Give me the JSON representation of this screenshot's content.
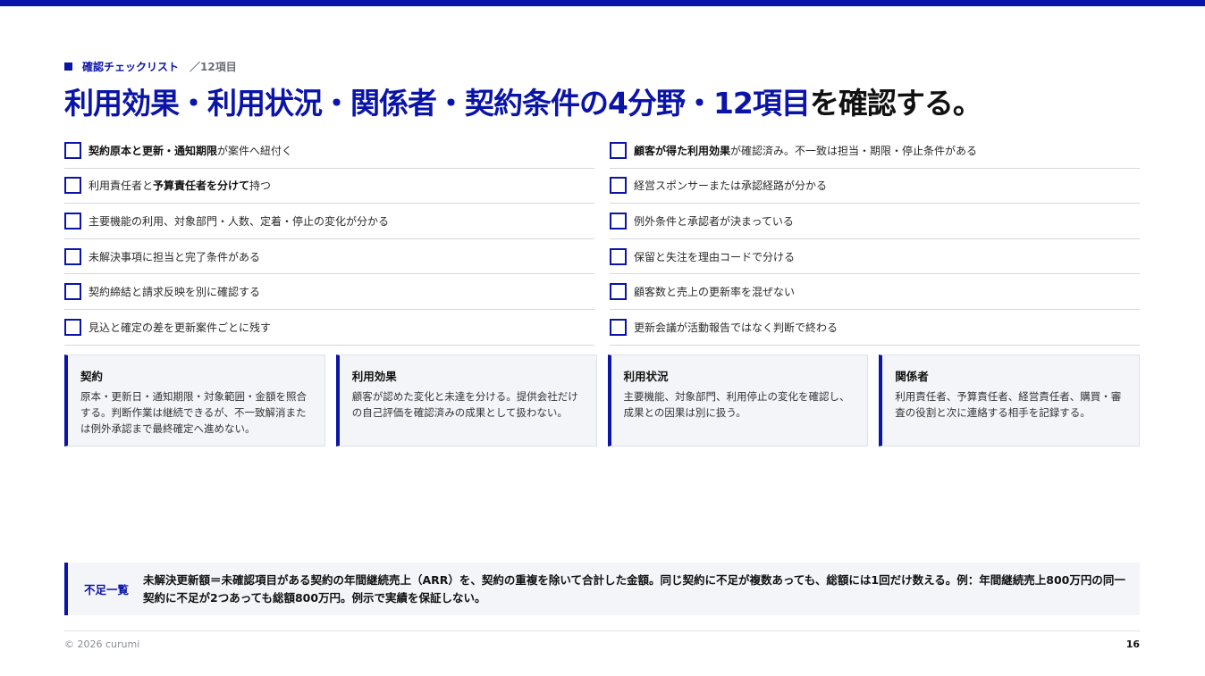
{
  "header": {
    "eyebrow_label": "確認チェックリスト",
    "eyebrow_count": "／12項目",
    "title_highlight": "利用効果・利用状況・関係者・契約条件の4分野・12項目",
    "title_rest": "を確認する。"
  },
  "checklist": {
    "left": [
      {
        "bold": "契約原本と更新・通知期限",
        "pre": "",
        "post": "が案件へ紐付く"
      },
      {
        "pre": "利用責任者と",
        "bold": "予算責任者を分けて",
        "post": "持つ"
      },
      {
        "pre": "主要機能の利用、対象部門・人数、定着・停止の変化が分かる",
        "bold": "",
        "post": ""
      },
      {
        "pre": "未解決事項に担当と完了条件がある",
        "bold": "",
        "post": ""
      },
      {
        "pre": "契約締結と請求反映を別に確認する",
        "bold": "",
        "post": ""
      },
      {
        "pre": "見込と確定の差を更新案件ごとに残す",
        "bold": "",
        "post": ""
      }
    ],
    "right": [
      {
        "bold": "顧客が得た利用効果",
        "pre": "",
        "post": "が確認済み。不一致は担当・期限・停止条件がある"
      },
      {
        "pre": "経営スポンサーまたは承認経路が分かる",
        "bold": "",
        "post": ""
      },
      {
        "pre": "例外条件と承認者が決まっている",
        "bold": "",
        "post": ""
      },
      {
        "pre": "保留と失注を理由コードで分ける",
        "bold": "",
        "post": ""
      },
      {
        "pre": "顧客数と売上の更新率を混ぜない",
        "bold": "",
        "post": ""
      },
      {
        "pre": "更新会議が活動報告ではなく判断で終わる",
        "bold": "",
        "post": ""
      }
    ]
  },
  "cards": [
    {
      "title": "契約",
      "desc": "原本・更新日・通知期限・対象範囲・金額を照合する。判断作業は継続できるが、不一致解消または例外承認まで最終確定へ進めない。"
    },
    {
      "title": "利用効果",
      "desc": "顧客が認めた変化と未達を分ける。提供会社だけの自己評価を確認済みの成果として扱わない。"
    },
    {
      "title": "利用状況",
      "desc": "主要機能、対象部門、利用停止の変化を確認し、成果との因果は別に扱う。"
    },
    {
      "title": "関係者",
      "desc": "利用責任者、予算責任者、経営責任者、購買・審査の役割と次に連絡する相手を記録する。"
    }
  ],
  "shortfall": {
    "label": "不足一覧",
    "text": "未解決更新額＝未確認項目がある契約の年間継続売上（ARR）を、契約の重複を除いて合計した金額。同じ契約に不足が複数あっても、総額には1回だけ数える。例：年間継続売上800万円の同一契約に不足が2つあっても総額800万円。例示で実績を保証しない。"
  },
  "footer": {
    "copyright": "© 2026 curumi",
    "page_number": "16"
  },
  "colors": {
    "accent": "#0a14a8",
    "card_bg": "#f4f5f9"
  }
}
